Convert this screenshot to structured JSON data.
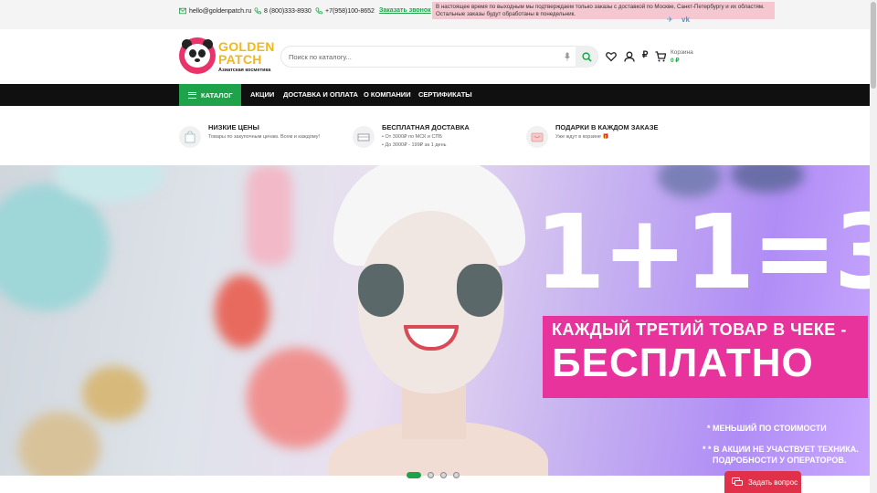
{
  "topbar": {
    "email": "hello@goldenpatch.ru",
    "phone1": "8 (800)333-8930",
    "phone2": "+7(958)100-8652",
    "callback": "Заказать звонок",
    "notice_line1": "В настоящее время по выходным мы подтверждаем только заказы с доставкой по Москве, Санкт-Петербургу и их областям.",
    "notice_line2": "Остальные заказы будут обработаны в понедельник.",
    "social_telegram": "✈",
    "social_vk": "vk"
  },
  "header": {
    "logo_line1": "GOLDEN",
    "logo_line2": "PATCH",
    "logo_tagline": "Азиатская косметика",
    "search_placeholder": "Поиск по каталогу...",
    "currency": "₽",
    "cart_label": "Корзина",
    "cart_sum": "0 ₽"
  },
  "nav": {
    "catalog": "КАТАЛОГ",
    "items": [
      "АКЦИИ",
      "ДОСТАВКА И ОПЛАТА",
      "О КОМПАНИИ",
      "СЕРТИФИКАТЫ"
    ]
  },
  "features": [
    {
      "title": "НИЗКИЕ ЦЕНЫ",
      "lines": [
        "Товары по закупочным ценам. Всем и каждому!"
      ]
    },
    {
      "title": "БЕСПЛАТНАЯ ДОСТАВКА",
      "lines": [
        "• От 3000₽ по МСК и СПБ",
        "• До 3000₽ - 199₽ за 1 день"
      ]
    },
    {
      "title": "ПОДАРКИ В КАЖДОМ ЗАКАЗЕ",
      "lines": [
        "Уже ждут в корзине 🎁"
      ]
    }
  ],
  "banner": {
    "headline": "1+1=3",
    "promo_line1": "КАЖДЫЙ ТРЕТИЙ ТОВАР В ЧЕКЕ -",
    "promo_line2": "БЕСПЛАТНО",
    "note1": "* МЕНЬШИЙ ПО СТОИМОСТИ",
    "note2": "* * В АКЦИИ НЕ УЧАСТВУЕТ ТЕХНИКА.",
    "note3": "ПОДРОБНОСТИ У ОПЕРАТОРОВ.",
    "slides_total": 4,
    "active_slide": 1
  },
  "ask_button": "Задать вопрос",
  "colors": {
    "accent": "#1fa34a",
    "notice_bg": "#f5c7d1",
    "promo": "#e8339c",
    "ask": "#e0304a",
    "logo": "#f0b81c"
  }
}
